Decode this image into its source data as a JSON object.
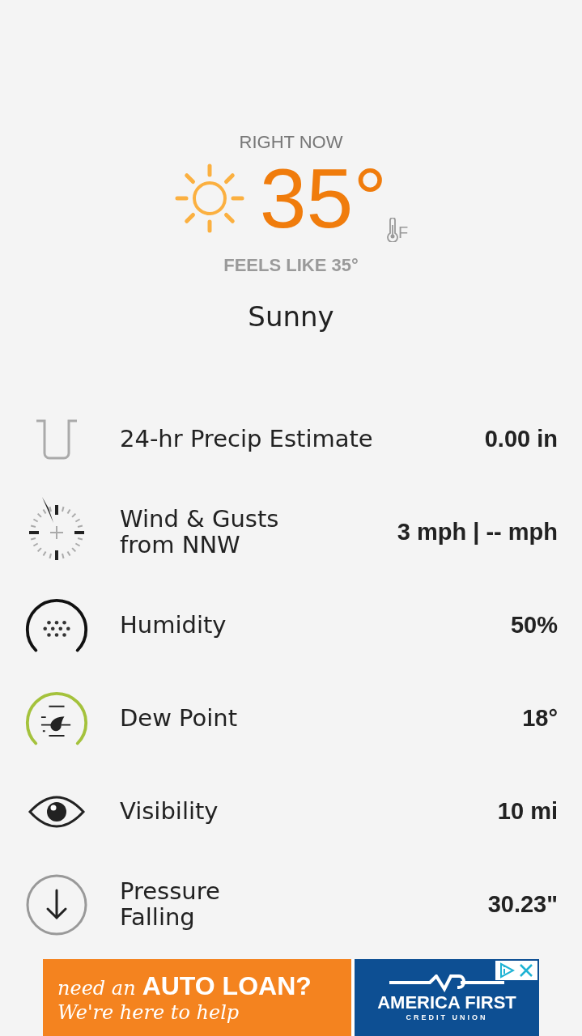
{
  "header": {
    "label": "RIGHT NOW",
    "temperature": "35°",
    "unit": "F",
    "feels_like": "FEELS LIKE 35°",
    "condition": "Sunny"
  },
  "details": [
    {
      "kind": "precip",
      "label": "24-hr Precip Estimate",
      "value": "0.00 in"
    },
    {
      "kind": "wind",
      "label": "Wind & Gusts\nfrom NNW",
      "value": "3 mph | -- mph"
    },
    {
      "kind": "humidity",
      "label": "Humidity",
      "value": "50%"
    },
    {
      "kind": "dewpoint",
      "label": "Dew Point",
      "value": "18°"
    },
    {
      "kind": "visibility",
      "label": "Visibility",
      "value": "10 mi"
    },
    {
      "kind": "pressure",
      "label": "Pressure\nFalling",
      "value": "30.23\""
    }
  ],
  "ad": {
    "lead": "need an",
    "headline": "AUTO LOAN?",
    "tagline": "We're here to help",
    "brand": "AMERICA FIRST",
    "brand_sub": "CREDIT UNION"
  }
}
